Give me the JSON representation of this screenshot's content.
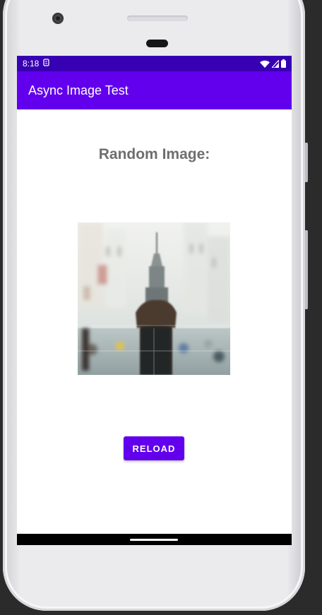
{
  "status_bar": {
    "time": "8:18",
    "notification_icon": "sim-card-icon",
    "icons": [
      "wifi-icon",
      "cell-signal-icon",
      "battery-icon"
    ],
    "background": "#3700b3"
  },
  "app_bar": {
    "title": "Async Image Test",
    "background": "#6200ee"
  },
  "main": {
    "heading": "Random Image:",
    "image": "blurred city street with skyscraper tower",
    "reload_label": "RELOAD"
  },
  "colors": {
    "accent": "#6200ee",
    "status_bar": "#3700b3",
    "heading_text": "#6e6e6e"
  }
}
